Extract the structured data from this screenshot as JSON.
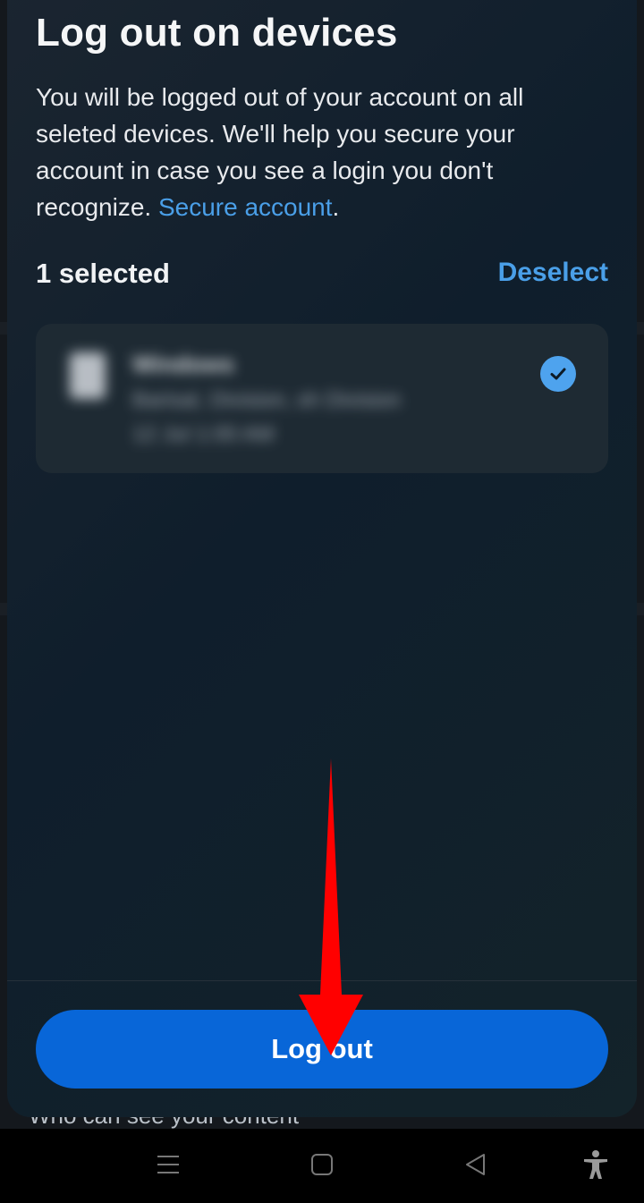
{
  "sheet": {
    "title": "Log out on devices",
    "description": "You will be logged out of your account on all seleted devices. We'll help you secure your account in case you see a login you don't recognize.",
    "secure_link": "Secure account",
    "secure_link_suffix": ".",
    "selected_count": "1 selected",
    "deselect_label": "Deselect",
    "device": {
      "name": "Windows",
      "location": "Barisal, Division, sh Division",
      "time": "12 Jul 1:00 AM",
      "selected": true,
      "icon": "device-icon"
    },
    "logout_label": "Log out"
  },
  "background": {
    "partial_text": "Who can see your content"
  },
  "nav": {
    "items": [
      "menu-icon",
      "home-icon",
      "back-icon",
      "accessibility-icon"
    ]
  },
  "colors": {
    "accent": "#4a9fe8",
    "primary_button": "#0866d8",
    "annotation_arrow": "#ff0000"
  }
}
